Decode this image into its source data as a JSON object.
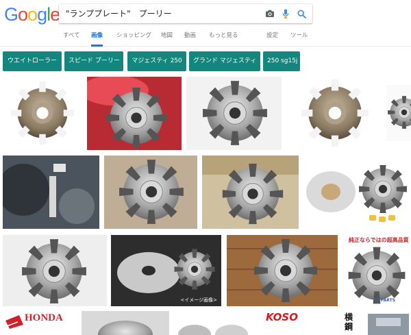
{
  "logo": {
    "letters": [
      "G",
      "o",
      "o",
      "g",
      "l",
      "e"
    ],
    "colors": [
      "#4285F4",
      "#EA4335",
      "#FBBC05",
      "#4285F4",
      "#34A853",
      "#EA4335"
    ]
  },
  "search": {
    "query": "\"ランププレート\"　プーリー"
  },
  "tabs": [
    {
      "label": "すべて",
      "active": false
    },
    {
      "label": "画像",
      "active": true
    },
    {
      "label": "ショッピング",
      "active": false
    },
    {
      "label": "地図",
      "active": false
    },
    {
      "label": "動画",
      "active": false
    },
    {
      "label": "もっと見る",
      "active": false
    },
    {
      "label": "設定",
      "active": false
    },
    {
      "label": "ツール",
      "active": false
    }
  ],
  "chips": [
    "ウエイトローラー",
    "スピード プーリー",
    "マジェスティ 250",
    "グランド マジェスティ",
    "250 sg15j"
  ],
  "thumb_texts": {
    "t14_caption": "<イメージ画像>",
    "t16_banner": "純正ならではの超高品質",
    "t16_brand": "YS PARTS",
    "t17_brand": "HONDA",
    "t20_brand": "KOSO",
    "t21_kanji": "横 鋼"
  },
  "colors": {
    "accent": "#1a73e8",
    "chip_bg": "#13877e"
  }
}
